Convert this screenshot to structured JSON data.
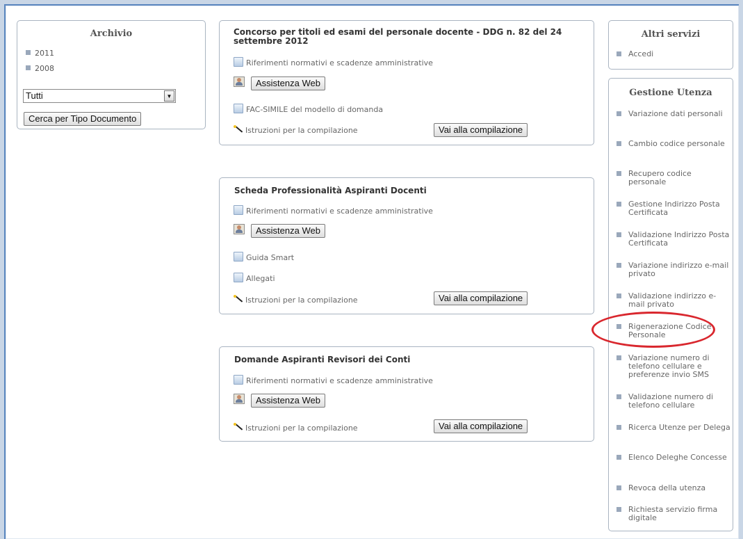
{
  "archivio": {
    "title": "Archivio",
    "years": [
      "2011",
      "2008"
    ],
    "select_value": "Tutti",
    "search_button": "Cerca per Tipo Documento"
  },
  "concorsi": [
    {
      "title": "Concorso per titoli ed esami del personale docente - DDG n. 82 del 24 settembre 2012",
      "riferimenti": "Riferimenti normativi e scadenze amministrative",
      "assistenza": "Assistenza Web",
      "docs": [
        "FAC-SIMILE del modello di domanda"
      ],
      "istruzioni": "Istruzioni per la compilazione",
      "compila": "Vai alla compilazione"
    },
    {
      "title": "Scheda Professionalità Aspiranti Docenti",
      "riferimenti": "Riferimenti normativi e scadenze amministrative",
      "assistenza": "Assistenza Web",
      "docs": [
        "Guida Smart",
        "Allegati"
      ],
      "istruzioni": "Istruzioni per la compilazione",
      "compila": "Vai alla compilazione"
    },
    {
      "title": "Domande Aspiranti Revisori dei Conti",
      "riferimenti": "Riferimenti normativi e scadenze amministrative",
      "assistenza": "Assistenza Web",
      "docs": [],
      "istruzioni": "Istruzioni per la compilazione",
      "compila": "Vai alla compilazione"
    }
  ],
  "altri_servizi": {
    "title": "Altri servizi",
    "items": [
      "Accedi"
    ]
  },
  "gestione_utenza": {
    "title": "Gestione Utenza",
    "items": [
      "Variazione dati personali",
      "Cambio codice personale",
      "Recupero codice personale",
      "Gestione Indirizzo Posta Certificata",
      "Validazione Indirizzo Posta Certificata",
      "Variazione indirizzo e-mail privato",
      "Validazione indirizzo e-mail privato",
      "Rigenerazione Codice Personale",
      "Variazione numero di telefono cellulare e preferenze invio SMS",
      "Validazione numero di telefono cellulare",
      "Ricerca Utenze per Delega",
      "Elenco Deleghe Concesse",
      "Revoca della utenza",
      "Richiesta servizio firma digitale"
    ]
  },
  "colors": {
    "frame_border": "#5a86bf",
    "panel_border": "#a9b4c1",
    "bullet": "#9aa8bb",
    "highlight_oval": "#d9272e"
  }
}
